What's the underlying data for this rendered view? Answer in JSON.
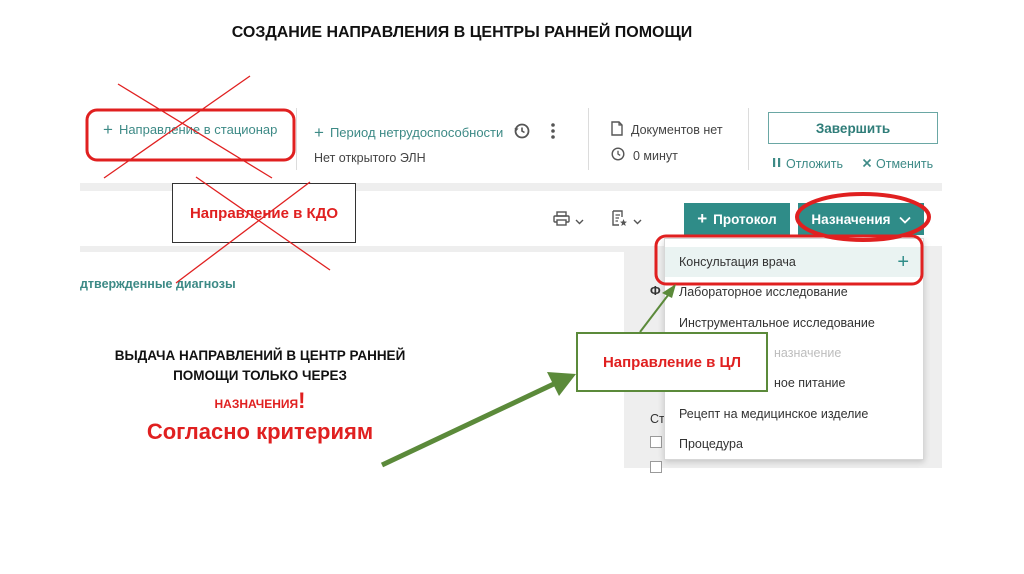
{
  "slide_title": "СОЗДАНИЕ НАПРАВЛЕНИЯ В ЦЕНТРЫ РАННЕЙ ПОМОЩИ",
  "toolbar": {
    "hospital_referral": "Направление в стационар",
    "sick_leave_period": "Период нетрудоспособности",
    "no_open_eln": "Нет открытого ЭЛН",
    "no_documents": "Документов нет",
    "minutes": "0 минут",
    "finish": "Завершить",
    "postpone": "Отложить",
    "cancel": "Отменить"
  },
  "actions": {
    "protocol": "Протокол",
    "appointments": "Назначения"
  },
  "dropdown": {
    "items": [
      "Консультация врача",
      "Лабораторное исследование",
      "Инструментальное исследование",
      "назначение",
      "ное питание",
      "Рецепт на медицинское изделие",
      "Процедура"
    ]
  },
  "panel": {
    "diagnoses_tab": "дтвержденные диагнозы",
    "right_peek_1": "Ф",
    "right_peek_2": "Ст"
  },
  "annotations": {
    "kdo": "Направление в КДО",
    "cl": "Направление в ЦЛ",
    "note_line1": "ВЫДАЧА НАПРАВЛЕНИЙ В ЦЕНТР РАННЕЙ",
    "note_line2": "ПОМОЩИ ТОЛЬКО ЧЕРЕЗ",
    "note_line3": "НАЗНАЧЕНИЯ",
    "note_excl": "!",
    "note_line4": "Согласно критериям"
  },
  "icons": {
    "history": "history-icon",
    "more": "kebab-menu-icon",
    "document": "document-icon",
    "clock": "clock-icon",
    "pause": "pause-icon",
    "close": "close-icon",
    "print": "printer-icon",
    "template": "template-icon",
    "chevron": "chevron-down-icon",
    "plus": "plus-icon"
  },
  "colors": {
    "teal": "#2f8c88",
    "link": "#3d8a86",
    "red_annotation": "#e02020",
    "green_annotation": "#5b8a3a"
  }
}
